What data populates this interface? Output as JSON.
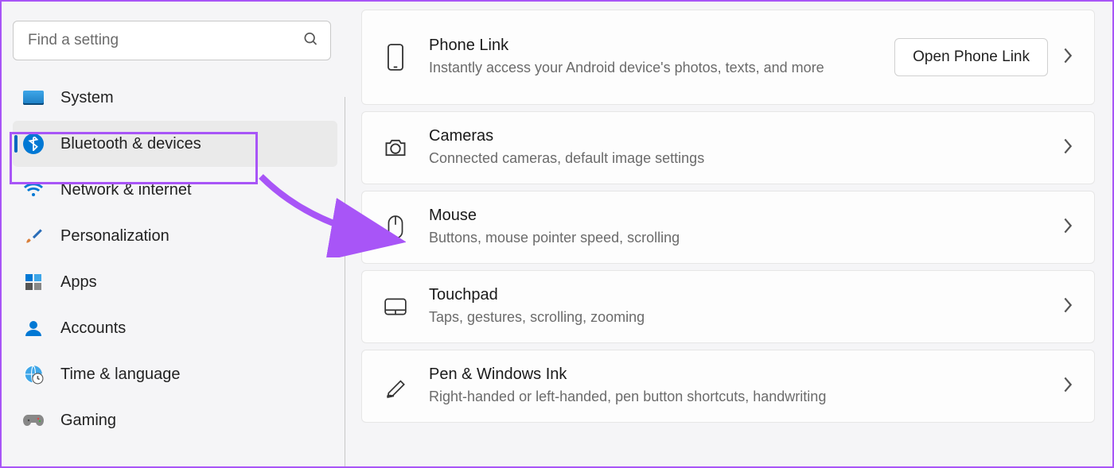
{
  "search": {
    "placeholder": "Find a setting"
  },
  "sidebar": {
    "items": [
      {
        "label": "System"
      },
      {
        "label": "Bluetooth & devices"
      },
      {
        "label": "Network & internet"
      },
      {
        "label": "Personalization"
      },
      {
        "label": "Apps"
      },
      {
        "label": "Accounts"
      },
      {
        "label": "Time & language"
      },
      {
        "label": "Gaming"
      }
    ]
  },
  "content": {
    "cards": [
      {
        "title": "Phone Link",
        "desc": "Instantly access your Android device's photos, texts, and more",
        "action": "Open Phone Link"
      },
      {
        "title": "Cameras",
        "desc": "Connected cameras, default image settings"
      },
      {
        "title": "Mouse",
        "desc": "Buttons, mouse pointer speed, scrolling"
      },
      {
        "title": "Touchpad",
        "desc": "Taps, gestures, scrolling, zooming"
      },
      {
        "title": "Pen & Windows Ink",
        "desc": "Right-handed or left-handed, pen button shortcuts, handwriting"
      }
    ]
  }
}
